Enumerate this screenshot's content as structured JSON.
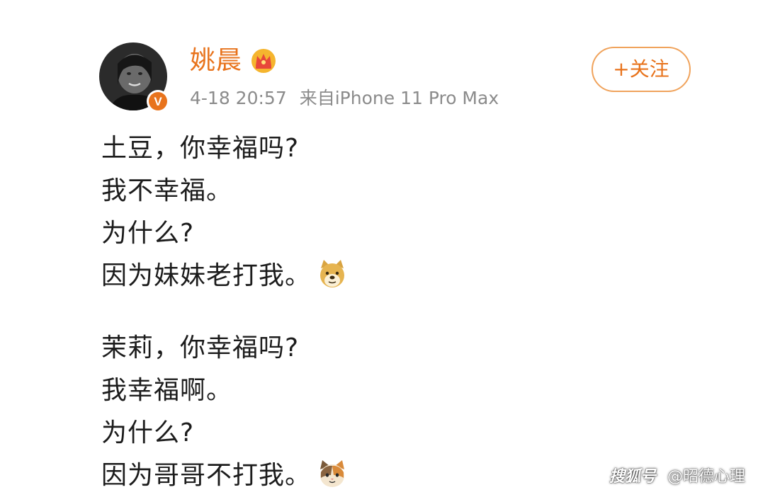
{
  "post": {
    "author": {
      "name": "姚晨",
      "avatar_icon": "user-avatar-photo",
      "verified_badge": "V",
      "vip_icon": "crown-icon"
    },
    "meta": {
      "timestamp": "4-18 20:57",
      "source": "来自iPhone 11 Pro Max"
    },
    "follow_label": "+关注",
    "paragraphs": [
      {
        "lines": [
          {
            "text": "土豆，你幸福吗?"
          },
          {
            "text": "我不幸福。"
          },
          {
            "text": "为什么?"
          },
          {
            "text": "因为妹妹老打我。",
            "emoji": "doge-emoji"
          }
        ]
      },
      {
        "lines": [
          {
            "text": "茉莉，你幸福吗?"
          },
          {
            "text": "我幸福啊。"
          },
          {
            "text": "为什么?"
          },
          {
            "text": "因为哥哥不打我。",
            "emoji": "cat-emoji"
          }
        ]
      }
    ]
  },
  "watermark": {
    "brand": "搜狐号",
    "account": "@昭德心理"
  },
  "colors": {
    "accent": "#e8731c",
    "text": "#1c1c1c",
    "meta": "#8b8b8b",
    "follow_border": "#f0a35c",
    "verified": "#e8731c"
  }
}
